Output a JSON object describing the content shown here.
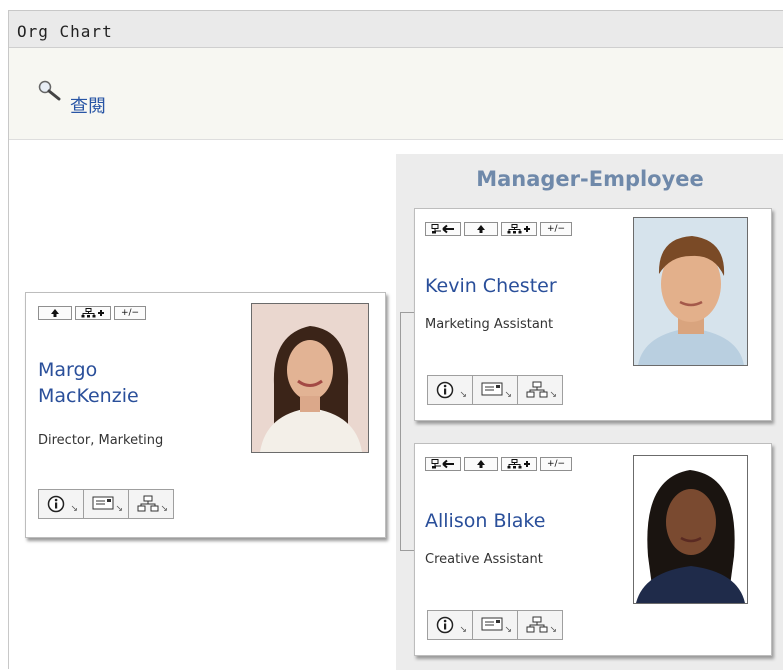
{
  "window": {
    "title": "Org Chart"
  },
  "toolbar": {
    "lookup_label": "查閱",
    "lookup_icon": "magnifier-icon"
  },
  "panel": {
    "title": "Manager-Employee"
  },
  "buttons": {
    "goto_manager": "goto-manager-icon",
    "up": "up-arrow-icon",
    "expand_reports": "expand-reports-icon",
    "toggle": "+/−"
  },
  "people": [
    {
      "name": "Margo MacKenzie",
      "role": "Director, Marketing"
    },
    {
      "name": "Kevin Chester",
      "role": "Marketing Assistant"
    },
    {
      "name": "Allison Blake",
      "role": "Creative Assistant"
    }
  ],
  "actions": {
    "info": "info-icon",
    "email": "email-icon",
    "org": "org-chart-icon"
  }
}
